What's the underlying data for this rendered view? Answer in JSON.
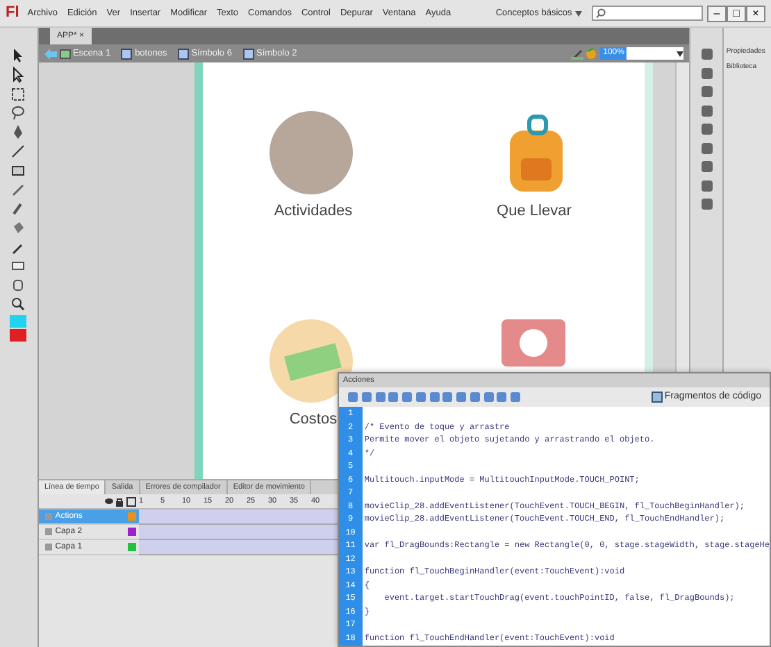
{
  "app": {
    "logo": "Fl",
    "menu": [
      "Archivo",
      "Edición",
      "Ver",
      "Insertar",
      "Modificar",
      "Texto",
      "Comandos",
      "Control",
      "Depurar",
      "Ventana",
      "Ayuda"
    ],
    "workspace": "Conceptos básicos",
    "window_buttons": [
      "–",
      "□",
      "×"
    ]
  },
  "document_tab": {
    "title": "APP*",
    "close": "×"
  },
  "breadcrumbs": [
    {
      "label": "Escena 1",
      "kind": "scene"
    },
    {
      "label": "botones",
      "kind": "symbol"
    },
    {
      "label": "Símbolo 6",
      "kind": "symbol"
    },
    {
      "label": "Símbolo 2",
      "kind": "symbol"
    }
  ],
  "zoom": {
    "value": "100%"
  },
  "stage": {
    "items": [
      {
        "kind": "photo",
        "label": "Actividades"
      },
      {
        "kind": "backpack",
        "label": "Que Llevar"
      },
      {
        "kind": "money",
        "label": "Costos"
      },
      {
        "kind": "camera"
      }
    ]
  },
  "right_panel": {
    "items": [
      "Propiedades",
      "Biblioteca"
    ]
  },
  "timeline": {
    "tabs": [
      {
        "label": "Línea de tiempo",
        "selected": true
      },
      {
        "label": "Salida",
        "selected": false
      },
      {
        "label": "Errores de compilador",
        "selected": false
      },
      {
        "label": "Editor de movimiento",
        "selected": false
      }
    ],
    "frame_numbers": [
      "1",
      "5",
      "10",
      "15",
      "20",
      "25",
      "30",
      "35",
      "40"
    ],
    "layers": [
      {
        "name": "Actions",
        "selected": true,
        "color": "#e8901a"
      },
      {
        "name": "Capa 2",
        "selected": false,
        "color": "#a020d0"
      },
      {
        "name": "Capa 1",
        "selected": false,
        "color": "#20c040"
      }
    ]
  },
  "actions_panel": {
    "title": "Acciones",
    "snippets": "Fragmentos de código",
    "lines": [
      {
        "number": "1"
      },
      {
        "number": "2",
        "code": "/* Evento de toque y arrastre"
      },
      {
        "number": "3",
        "code": "Permite mover el objeto sujetando y arrastrando el objeto."
      },
      {
        "number": "4",
        "code": "*/"
      },
      {
        "number": "5"
      },
      {
        "number": "6",
        "code": "Multitouch.inputMode = MultitouchInputMode.TOUCH_POINT;"
      },
      {
        "number": "7"
      },
      {
        "number": "8",
        "code": "movieClip_28.addEventListener(TouchEvent.TOUCH_BEGIN, fl_TouchBeginHandler);"
      },
      {
        "number": "9",
        "code": "movieClip_28.addEventListener(TouchEvent.TOUCH_END, fl_TouchEndHandler);"
      },
      {
        "number": "10"
      },
      {
        "number": "11",
        "code": "var fl_DragBounds:Rectangle = new Rectangle(0, 0, stage.stageWidth, stage.stageHe"
      },
      {
        "number": "12"
      },
      {
        "number": "13",
        "code": "function fl_TouchBeginHandler(event:TouchEvent):void"
      },
      {
        "number": "14",
        "code": "{"
      },
      {
        "number": "15",
        "code": "    event.target.startTouchDrag(event.touchPointID, false, fl_DragBounds);"
      },
      {
        "number": "16",
        "code": "}"
      },
      {
        "number": "17"
      },
      {
        "number": "18",
        "code": "function fl_TouchEndHandler(event:TouchEvent):void"
      }
    ]
  }
}
